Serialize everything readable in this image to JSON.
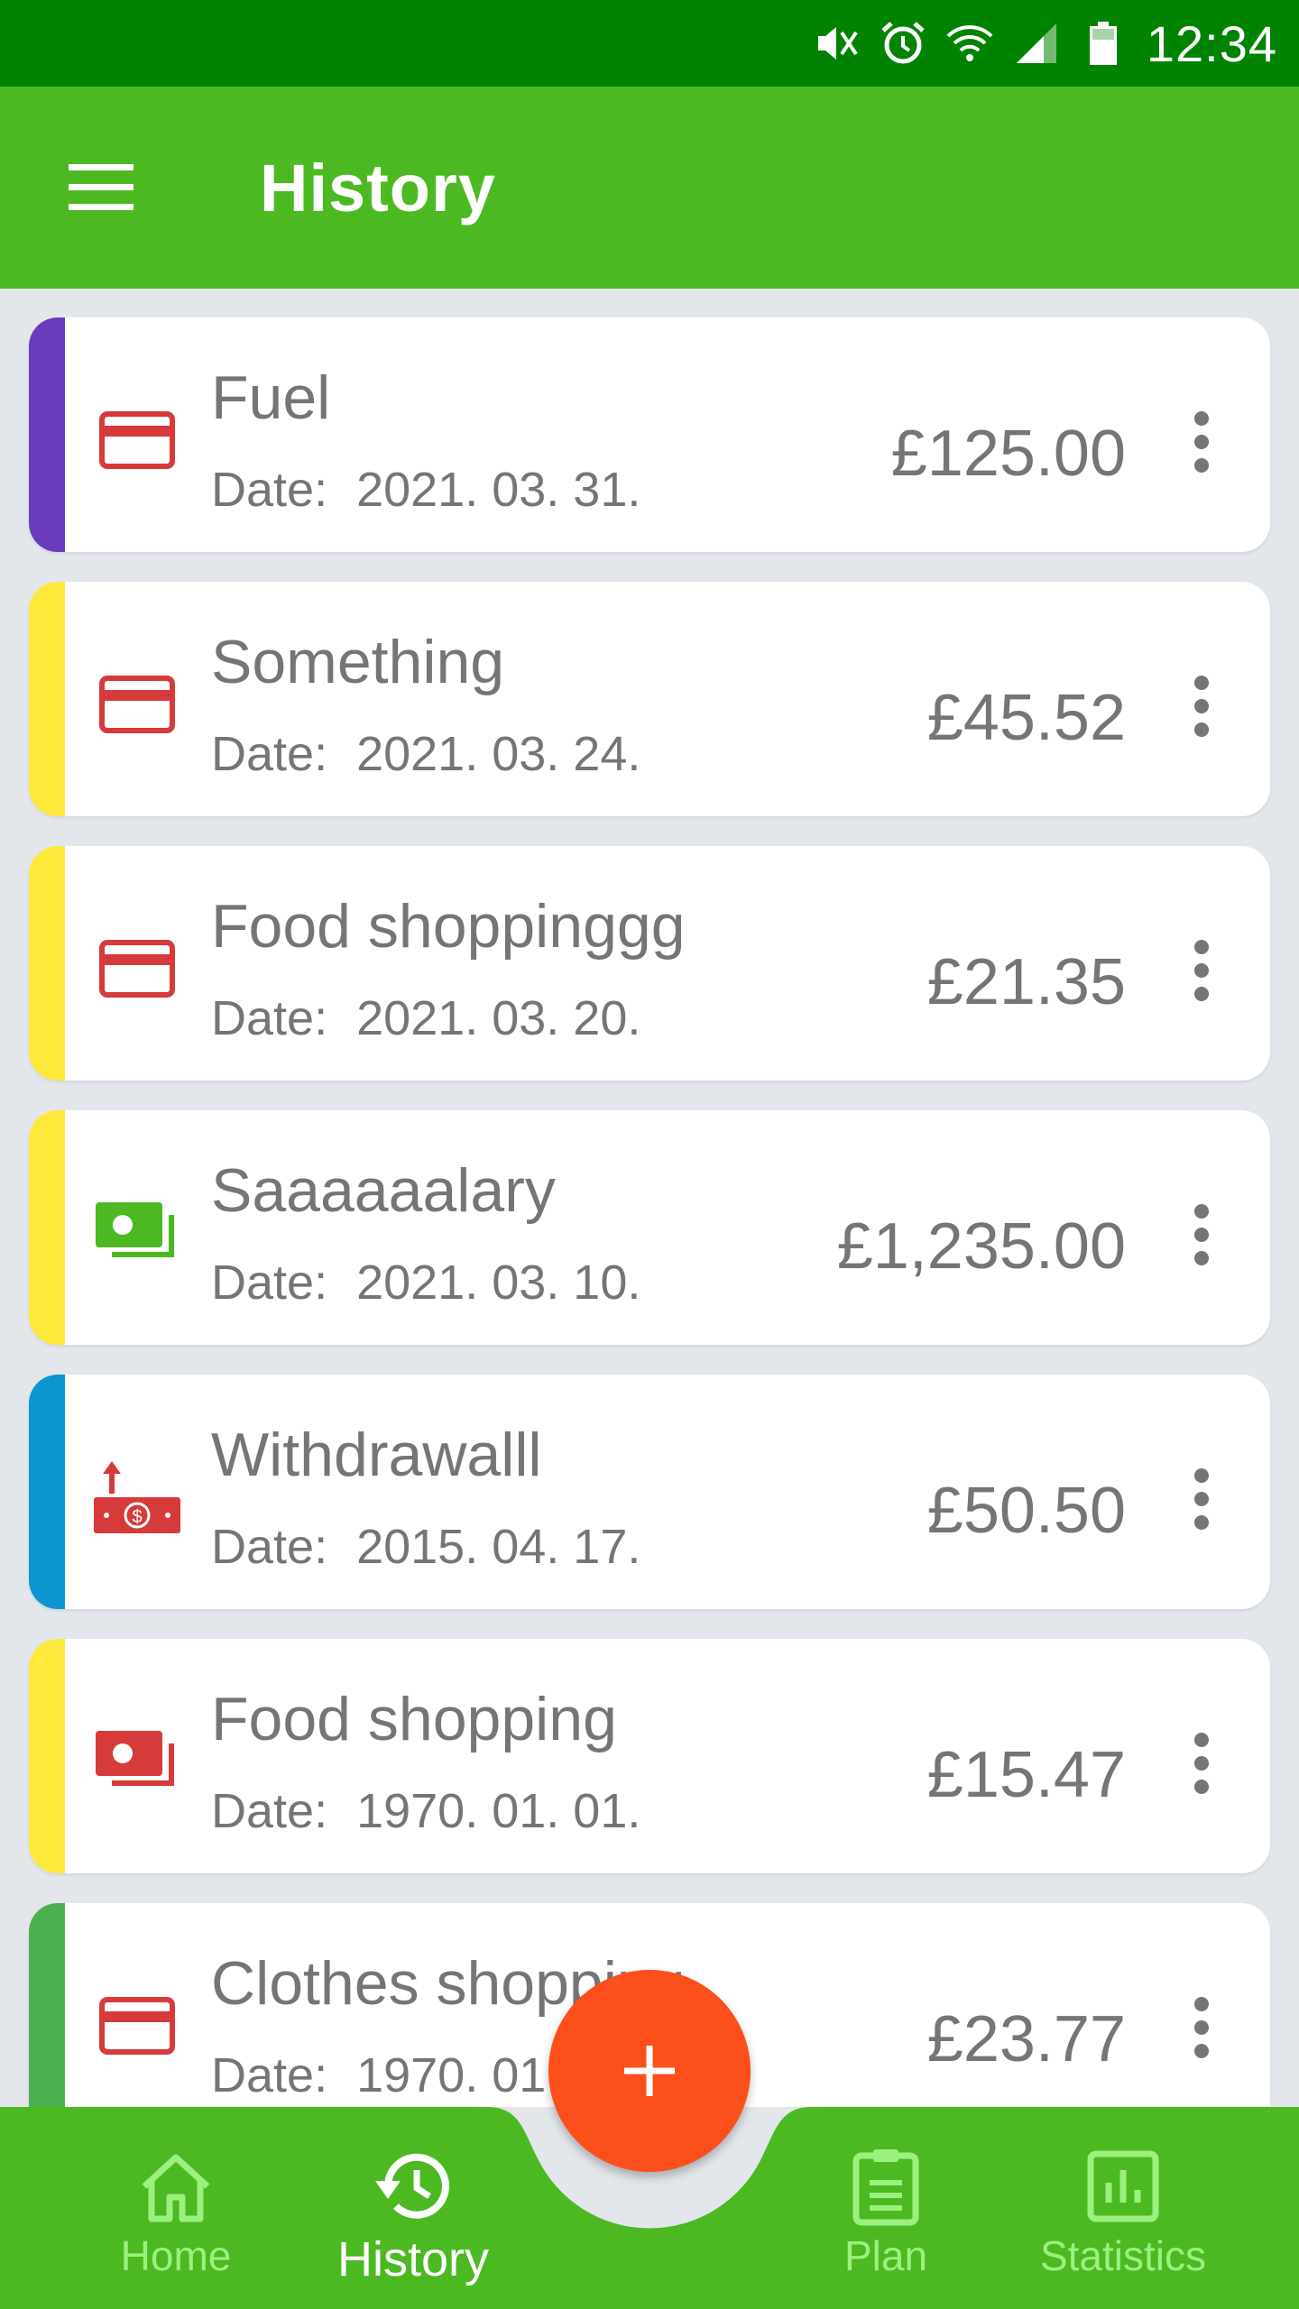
{
  "status_bar": {
    "time": "12:34",
    "icons": [
      "mute-vibrate-icon",
      "alarm-icon",
      "wifi-icon",
      "signal-icon",
      "battery-icon"
    ]
  },
  "app_bar": {
    "title": "History",
    "menu_icon": "hamburger-menu-icon"
  },
  "date_label": "Date:",
  "transactions": [
    {
      "title": "Fuel",
      "date": "2021. 03. 31.",
      "amount": "£125.00",
      "icon": "credit-card-icon",
      "stripe": "#6a3cbc",
      "icon_color": "#d63a3a"
    },
    {
      "title": "Something",
      "date": "2021. 03. 24.",
      "amount": "£45.52",
      "icon": "credit-card-icon",
      "stripe": "#fde93c",
      "icon_color": "#d63a3a"
    },
    {
      "title": "Food shoppinggg",
      "date": "2021. 03. 20.",
      "amount": "£21.35",
      "icon": "credit-card-icon",
      "stripe": "#fde93c",
      "icon_color": "#d63a3a"
    },
    {
      "title": "Saaaaaalary",
      "date": "2021. 03. 10.",
      "amount": "£1,235.00",
      "icon": "cash-icon",
      "stripe": "#fde93c",
      "icon_color": "#4cb923"
    },
    {
      "title": "Withdrawalll",
      "date": "2015. 04. 17.",
      "amount": "£50.50",
      "icon": "withdraw-cash-icon",
      "stripe": "#0d95d1",
      "icon_color": "#d63a3a"
    },
    {
      "title": "Food shopping",
      "date": "1970. 01. 01.",
      "amount": "£15.47",
      "icon": "cash-icon",
      "stripe": "#fde93c",
      "icon_color": "#d63a3a"
    },
    {
      "title": "Clothes shopping",
      "date": "1970. 01. 01.",
      "amount": "£23.77",
      "icon": "credit-card-icon",
      "stripe": "#4caf50",
      "icon_color": "#d63a3a"
    }
  ],
  "fab": {
    "icon": "plus-icon",
    "color": "#fd4f1c"
  },
  "bottom_nav": {
    "items": [
      {
        "label": "Home",
        "icon": "home-icon",
        "active": false
      },
      {
        "label": "History",
        "icon": "history-icon",
        "active": true
      },
      {
        "label": "Plan",
        "icon": "clipboard-icon",
        "active": false
      },
      {
        "label": "Statistics",
        "icon": "bar-chart-icon",
        "active": false
      }
    ]
  },
  "colors": {
    "status_bar": "#008300",
    "app_bar": "#4cb923",
    "background": "#e3e7ec",
    "nav_inactive": "#9bf07e",
    "text": "#757575"
  }
}
